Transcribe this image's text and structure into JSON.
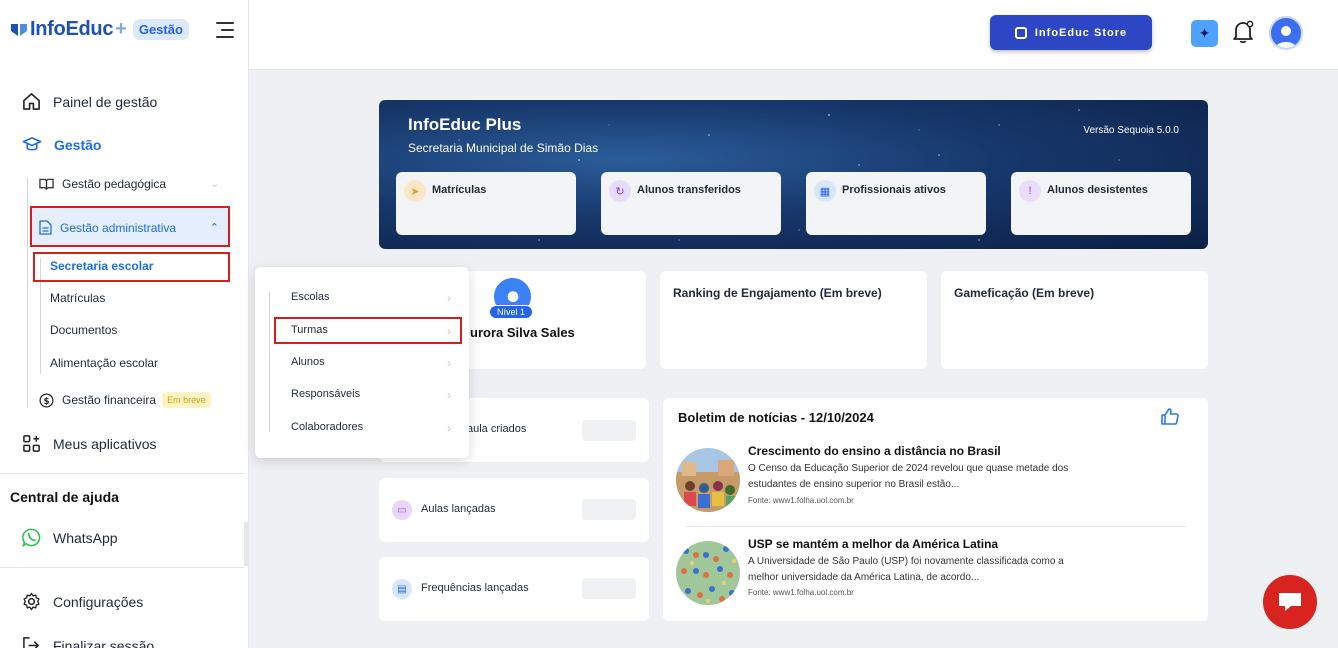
{
  "brand": {
    "name": "InfoEduc",
    "plus": "+",
    "badge": "Gestão"
  },
  "sidebar": {
    "painel": "Painel de gestão",
    "gestao": "Gestão",
    "gestao_pedagogica": "Gestão pedagógica",
    "gestao_administrativa": "Gestão administrativa",
    "sub": [
      "Secretaria escolar",
      "Matrículas",
      "Documentos",
      "Alimentação escolar"
    ],
    "gestao_financeira": "Gestão financeira",
    "em_breve": "Em breve",
    "meus_aplicativos": "Meus aplicativos",
    "help_title": "Central de ajuda",
    "whatsapp": "WhatsApp",
    "configuracoes": "Configurações",
    "finalizar": "Finalizar sessão"
  },
  "topbar": {
    "store": "InfoEduc Store"
  },
  "banner": {
    "title": "InfoEduc Plus",
    "subtitle": "Secretaria Municipal de Simão Dias",
    "version": "Versão Sequoia 5.0.0",
    "stats": [
      "Matrículas",
      "Alunos transferidos",
      "Profissionais ativos",
      "Alunos desistentes"
    ]
  },
  "user": {
    "level": "Nível 1",
    "name": "urora Silva Sales"
  },
  "cards": {
    "ranking": "Ranking de Engajamento (Em breve)",
    "gamificacao": "Gameficação (Em breve)"
  },
  "metrics": [
    "aula criados",
    "Aulas lançadas",
    "Frequências lançadas"
  ],
  "news": {
    "title": "Boletim de notícias - 12/10/2024",
    "items": [
      {
        "headline": "Crescimento do ensino a distância no Brasil",
        "body": "O Censo da Educação Superior de 2024 revelou que quase metade dos estudantes de ensino superior no Brasil estão...",
        "source": "Fonte: www1.folha.uol.com.br"
      },
      {
        "headline": "USP se mantém a melhor da América Latina",
        "body": "A Universidade de São Paulo (USP) foi novamente classificada como a melhor universidade da América Latina, de acordo...",
        "source": "Fonte: www1.folha.uol.com.br"
      }
    ]
  },
  "popup": [
    "Escolas",
    "Turmas",
    "Alunos",
    "Responsáveis",
    "Colaboradores"
  ],
  "colors": {
    "accent": "#2563eb",
    "highlight": "#d91c1c",
    "store": "#2d47c4"
  }
}
